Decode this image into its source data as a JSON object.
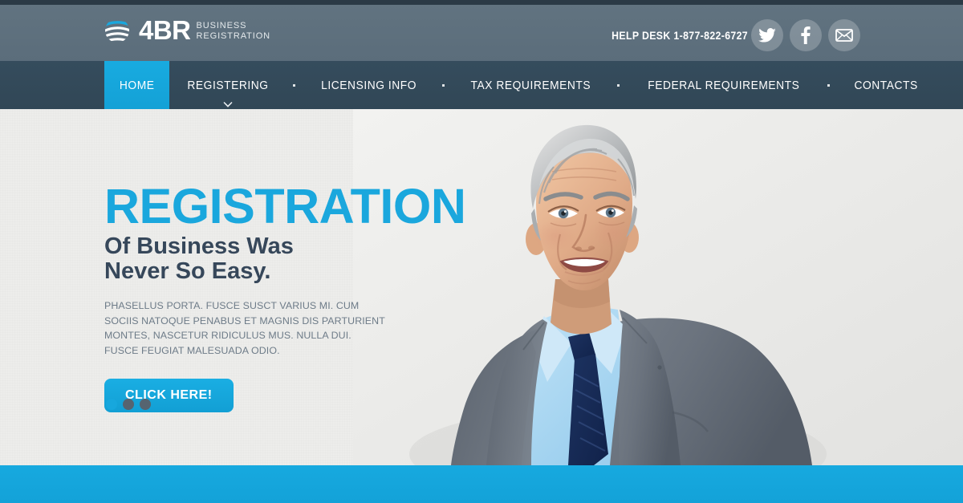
{
  "site": {
    "logo_name": "4BR",
    "logo_tagline_line1": "BUSINESS",
    "logo_tagline_line2": "REGISTRATION",
    "logo_icon": "globe-swirl-icon"
  },
  "header": {
    "helpdesk_label": "HELP DESK",
    "helpdesk_phone": "1-877-822-6727",
    "socials": [
      {
        "name": "twitter",
        "icon": "twitter-icon",
        "label": "Twitter"
      },
      {
        "name": "facebook",
        "icon": "facebook-icon",
        "label": "Facebook"
      },
      {
        "name": "email",
        "icon": "envelope-icon",
        "label": "Email"
      }
    ]
  },
  "nav": {
    "items": [
      {
        "label": "HOME",
        "active": true,
        "has_dropdown": false
      },
      {
        "label": "REGISTERING",
        "active": false,
        "has_dropdown": true
      },
      {
        "label": "LICENSING INFO",
        "active": false,
        "has_dropdown": false
      },
      {
        "label": "TAX REQUIREMENTS",
        "active": false,
        "has_dropdown": false
      },
      {
        "label": "FEDERAL REQUIREMENTS",
        "active": false,
        "has_dropdown": false
      },
      {
        "label": "CONTACTS",
        "active": false,
        "has_dropdown": false
      }
    ],
    "separator": "·"
  },
  "hero": {
    "title": "REGISTRATION",
    "subtitle_line1": "Of Business Was",
    "subtitle_line2": "Never So Easy.",
    "paragraph": "PHASELLUS PORTA. FUSCE SUSCT VARIUS MI. CUM SOCIIS NATOQUE PENABUS ET MAGNIS DIS PARTURIENT MONTES, NASCETUR RIDICULUS MUS. NULLA DUI. FUSCE FEUGIAT MALESUADA ODIO.",
    "cta_label": "CLICK HERE!",
    "slider_dots": [
      {
        "index": 1,
        "active": true
      },
      {
        "index": 2,
        "active": false
      },
      {
        "index": 3,
        "active": false
      }
    ],
    "photo_alt": "smiling businessman in gray suit, light blue shirt and navy tie"
  },
  "colors": {
    "accent_cyan": "#16a6dc",
    "nav_dark": "#334a5b",
    "header_slate": "#5e707e",
    "top_strip": "#2b3a46",
    "hero_bg": "#ededeb",
    "heading_dark": "#36475a",
    "body_text": "#6d7b88",
    "dot_inactive": "#566470"
  }
}
